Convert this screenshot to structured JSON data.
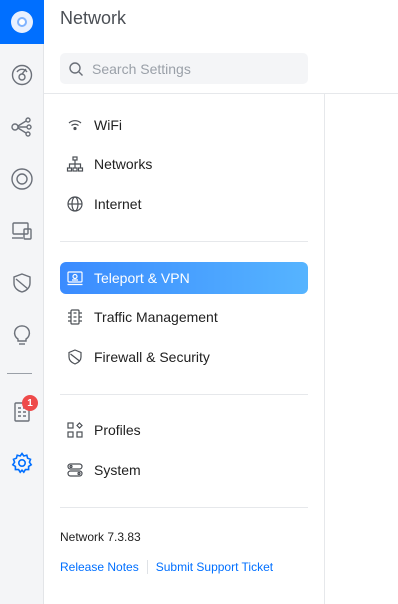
{
  "header": {
    "title": "Network"
  },
  "search": {
    "placeholder": "Search Settings",
    "value": ""
  },
  "menu": {
    "group1": [
      {
        "label": "WiFi",
        "icon": "wifi-icon"
      },
      {
        "label": "Networks",
        "icon": "network-topology-icon"
      },
      {
        "label": "Internet",
        "icon": "globe-icon"
      }
    ],
    "group2": [
      {
        "label": "Teleport & VPN",
        "icon": "teleport-vpn-icon",
        "active": true
      },
      {
        "label": "Traffic Management",
        "icon": "traffic-icon"
      },
      {
        "label": "Firewall & Security",
        "icon": "shield-icon"
      }
    ],
    "group3": [
      {
        "label": "Profiles",
        "icon": "profiles-icon"
      },
      {
        "label": "System",
        "icon": "system-icon"
      }
    ]
  },
  "footer": {
    "version": "Network 7.3.83",
    "release_notes": "Release Notes",
    "support": "Submit Support Ticket"
  },
  "rail": {
    "notification_count": "1",
    "icons": [
      "unifi-logo-icon",
      "dashboard-icon",
      "topology-icon",
      "devices-icon",
      "client-devices-icon",
      "security-icon",
      "insights-icon",
      "notifications-icon",
      "settings-icon"
    ]
  },
  "colors": {
    "accent": "#006fff",
    "active_start": "#3a8bff",
    "active_end": "#56b4ff",
    "badge": "#ee4a4a"
  }
}
